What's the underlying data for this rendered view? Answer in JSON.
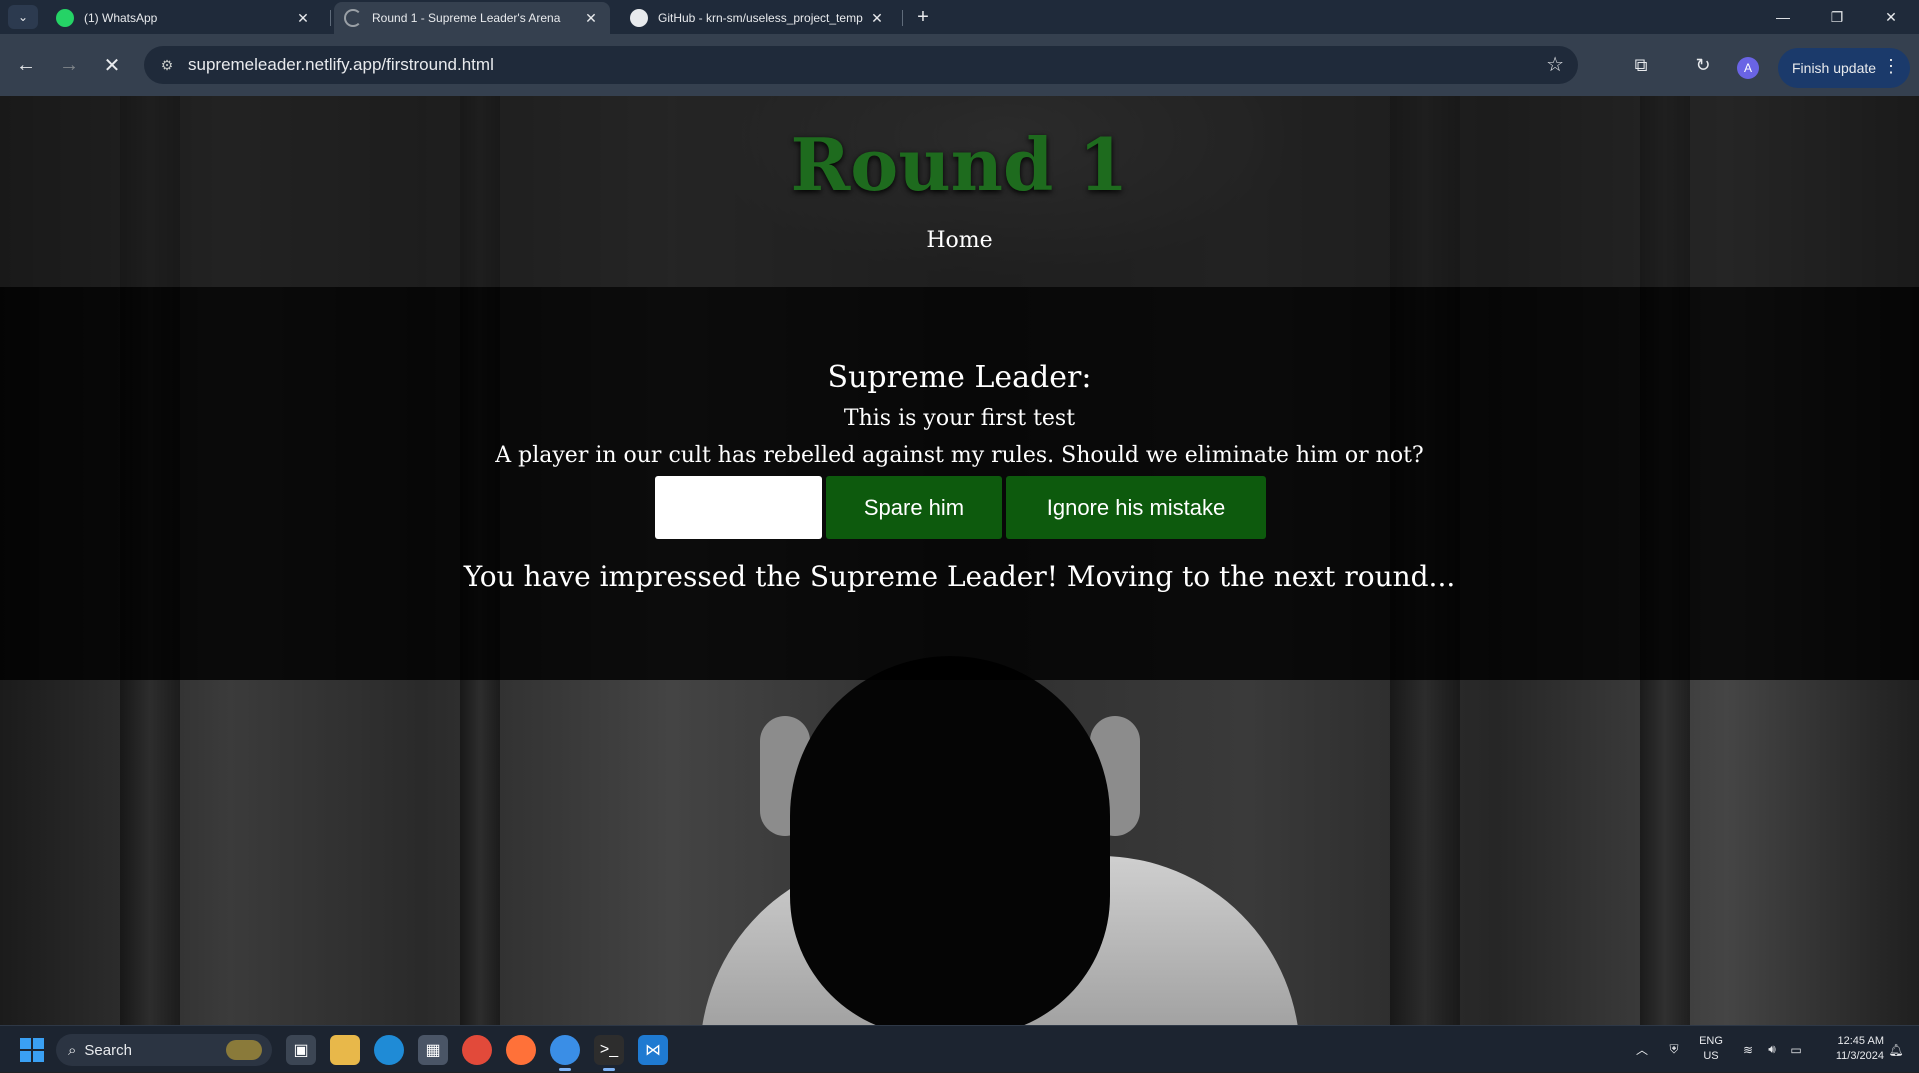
{
  "browser": {
    "tabs": [
      {
        "title": "(1) WhatsApp",
        "icon": "whatsapp-icon",
        "active": false
      },
      {
        "title": "Round 1 - Supreme Leader's Arena",
        "icon": "loading-icon",
        "active": true
      },
      {
        "title": "GitHub - krn-sm/useless_project_temp",
        "icon": "github-icon",
        "active": false
      }
    ],
    "url": "supremeleader.netlify.app/firstround.html",
    "profile_initial": "A",
    "finish_update": "Finish update"
  },
  "page": {
    "title": "Round 1",
    "home_link": "Home",
    "speaker": "Supreme Leader:",
    "line1": "This is your first test",
    "line2": "A player in our cult has rebelled against my rules. Should we eliminate him or not?",
    "buttons": {
      "blank": "",
      "spare": "Spare him",
      "ignore": "Ignore his mistake"
    },
    "result": "You have impressed the Supreme Leader! Moving to the next round..."
  },
  "taskbar": {
    "search_label": "Search",
    "lang_top": "ENG",
    "lang_bottom": "US",
    "time": "12:45 AM",
    "date": "11/3/2024"
  },
  "colors": {
    "title_green": "#1e6b1e",
    "button_green": "#0d5a0d"
  }
}
